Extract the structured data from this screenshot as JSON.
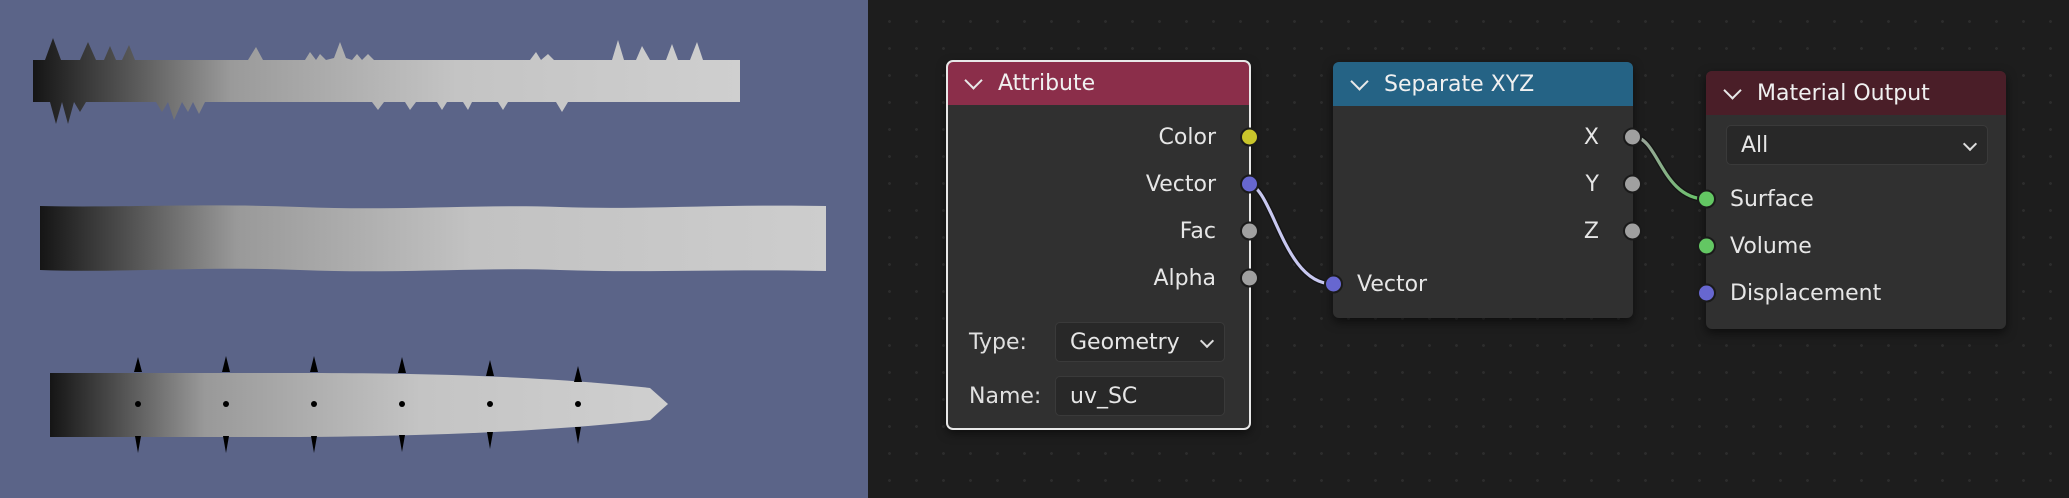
{
  "viewport": {
    "name": "3D Viewport preview",
    "background": "#5b6488"
  },
  "nodes": {
    "attribute": {
      "title": "Attribute",
      "header_color": "#8b2e4a",
      "outputs": [
        {
          "label": "Color",
          "color": "#c9c52b"
        },
        {
          "label": "Vector",
          "color": "#6767d0"
        },
        {
          "label": "Fac",
          "color": "#a0a0a0"
        },
        {
          "label": "Alpha",
          "color": "#a0a0a0"
        }
      ],
      "type_label": "Type:",
      "type_value": "Geometry",
      "name_label": "Name:",
      "name_value": "uv_SC"
    },
    "separate_xyz": {
      "title": "Separate XYZ",
      "header_color": "#256385",
      "outputs": [
        {
          "label": "X",
          "color": "#a0a0a0"
        },
        {
          "label": "Y",
          "color": "#a0a0a0"
        },
        {
          "label": "Z",
          "color": "#a0a0a0"
        }
      ],
      "inputs": [
        {
          "label": "Vector",
          "color": "#6767d0"
        }
      ]
    },
    "material_output": {
      "title": "Material Output",
      "header_color": "#4a1e28",
      "target_value": "All",
      "inputs": [
        {
          "label": "Surface",
          "color": "#63c763"
        },
        {
          "label": "Volume",
          "color": "#63c763"
        },
        {
          "label": "Displacement",
          "color": "#6767d0"
        }
      ]
    }
  },
  "links": [
    {
      "from": "Attribute.Vector",
      "to": "Separate XYZ.Vector",
      "color": "#c8c8f0"
    },
    {
      "from": "Separate XYZ.X",
      "to": "Material Output.Surface",
      "color_start": "#a0a0a0",
      "color_end": "#63c763"
    }
  ]
}
